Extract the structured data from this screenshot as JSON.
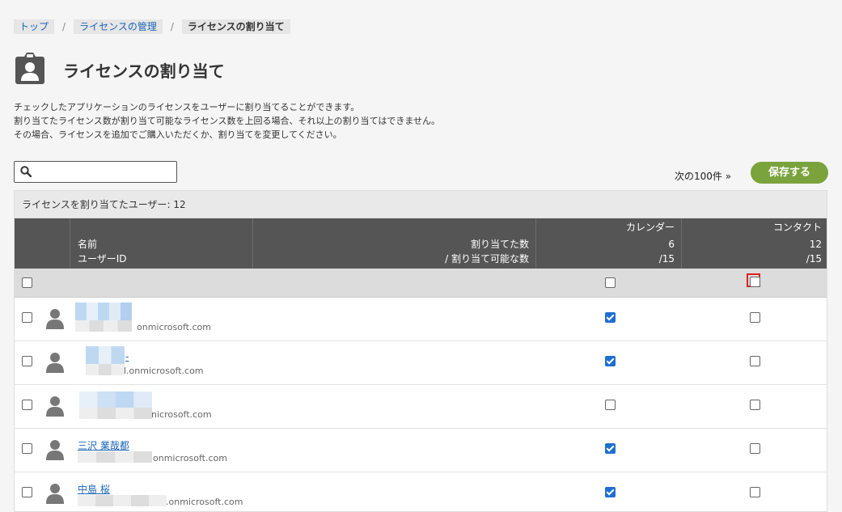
{
  "breadcrumb": {
    "top": "トップ",
    "license_mgmt": "ライセンスの管理",
    "current": "ライセンスの割り当て",
    "separator": "/"
  },
  "page": {
    "title": "ライセンスの割り当て",
    "description": [
      "チェックしたアプリケーションのライセンスをユーザーに割り当てることができます。",
      "割り当てたライセンス数が割り当て可能なライセンス数を上回る場合、それ以上の割り当てはできません。",
      "その場合、ライセンスを追加でご購入いただくか、割り当てを変更してください。"
    ]
  },
  "search": {
    "value": "",
    "placeholder": ""
  },
  "toolbar": {
    "next_label": "次の100件 »",
    "save_label": "保存する"
  },
  "table": {
    "assigned_users_label": "ライセンスを割り当てたユーザー: 12",
    "headers": {
      "name": "名前",
      "user_id": "ユーザーID",
      "assigned": "割り当てた数",
      "assignable": "/ 割り当て可能な数",
      "calendar": {
        "label": "カレンダー",
        "assigned": "6",
        "total": "/15"
      },
      "contact": {
        "label": "コンタクト",
        "assigned": "12",
        "total": "/15"
      }
    },
    "select_all": {
      "calendar": false,
      "contact": false
    },
    "rows": [
      {
        "name": "",
        "user_id": "onmicrosoft.com",
        "calendar": true,
        "contact": false
      },
      {
        "name": "-",
        "user_id": "l.onmicrosoft.com",
        "calendar": true,
        "contact": false
      },
      {
        "name": "",
        "user_id": "nicrosoft.com",
        "calendar": false,
        "contact": false
      },
      {
        "name": "三沢 業哉都",
        "user_id": "onmicrosoft.com",
        "calendar": true,
        "contact": false
      },
      {
        "name": "中島 桜",
        "user_id": ".onmicrosoft.com",
        "calendar": true,
        "contact": false
      }
    ]
  },
  "colors": {
    "accent": "#7aa33d",
    "link": "#1a64b8",
    "header_bg": "#555555",
    "check": "#1f6fd1",
    "highlight": "#e02020"
  },
  "icons": {
    "title": "user-badge-icon",
    "search": "search-icon",
    "avatar": "user-icon"
  }
}
